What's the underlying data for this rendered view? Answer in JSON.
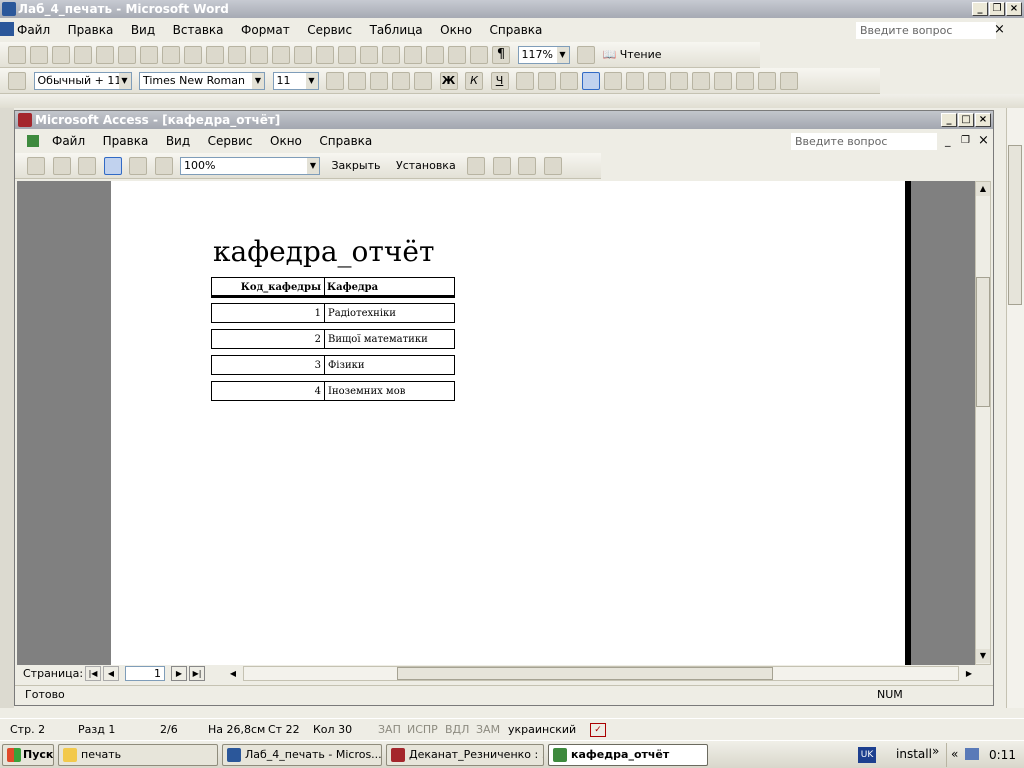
{
  "word": {
    "title": "Лаб_4_печать - Microsoft Word",
    "menu": [
      "Файл",
      "Правка",
      "Вид",
      "Вставка",
      "Формат",
      "Сервис",
      "Таблица",
      "Окно",
      "Справка"
    ],
    "ask_placeholder": "Введите вопрос",
    "zoom": "117%",
    "read_label": "Чтение",
    "style_value": "Обычный + 11 г",
    "font_value": "Times New Roman",
    "size_value": "11",
    "bold": "Ж",
    "italic": "К",
    "underline": "Ч",
    "status": {
      "page": "Стр. 2",
      "section": "Разд 1",
      "pages": "2/6",
      "at": "На 26,8см",
      "line": "Ст 22",
      "col": "Кол 30",
      "rec": "ЗАП",
      "trk": "ИСПР",
      "ext": "ВДЛ",
      "ovr": "ЗАМ",
      "lang": "украинский"
    }
  },
  "access": {
    "title": "Microsoft Access - [кафедра_отчёт]",
    "menu": [
      "Файл",
      "Правка",
      "Вид",
      "Сервис",
      "Окно",
      "Справка"
    ],
    "ask_placeholder": "Введите вопрос",
    "zoom": "100%",
    "close_label": "Закрыть",
    "setup_label": "Установка",
    "status_ready": "Готово",
    "status_num": "NUM",
    "page_nav_label": "Страница:",
    "page_value": "1"
  },
  "report": {
    "title": "кафедра_отчёт",
    "columns": [
      "Код_кафедры",
      "Кафедра"
    ],
    "rows": [
      {
        "code": "1",
        "name": "Радіотехніки"
      },
      {
        "code": "2",
        "name": "Вищої математики"
      },
      {
        "code": "3",
        "name": "Фізики"
      },
      {
        "code": "4",
        "name": "Іноземних мов"
      }
    ]
  },
  "taskbar": {
    "start": "Пуск",
    "tasks": [
      "печать",
      "Лаб_4_печать - Micros...",
      "Деканат_Резниченко : ...",
      "кафедра_отчёт"
    ],
    "lang": "UK",
    "install": "install",
    "clock": "0:11"
  },
  "colors": {
    "accent": "#316ac5",
    "title_inactive": "#a6aab3"
  }
}
